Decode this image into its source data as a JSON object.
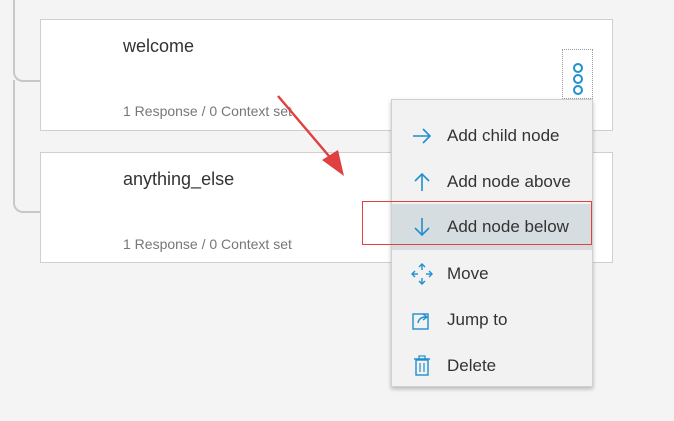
{
  "nodes": [
    {
      "title": "welcome",
      "meta": "1 Response / 0 Context set"
    },
    {
      "title": "anything_else",
      "meta": "1 Response / 0 Context set"
    }
  ],
  "menu": {
    "items": [
      {
        "label": "Add child node",
        "icon": "arrow-right-icon"
      },
      {
        "label": "Add node above",
        "icon": "arrow-up-icon"
      },
      {
        "label": "Add node below",
        "icon": "arrow-down-icon"
      },
      {
        "label": "Move",
        "icon": "move-icon"
      },
      {
        "label": "Jump to",
        "icon": "jump-to-icon"
      },
      {
        "label": "Delete",
        "icon": "trash-icon"
      }
    ],
    "highlighted_item": "Add node below"
  },
  "colors": {
    "icon_blue": "#1f8fcf",
    "annotation_red": "#e0403f",
    "highlight_bg": "#d6dde0"
  }
}
